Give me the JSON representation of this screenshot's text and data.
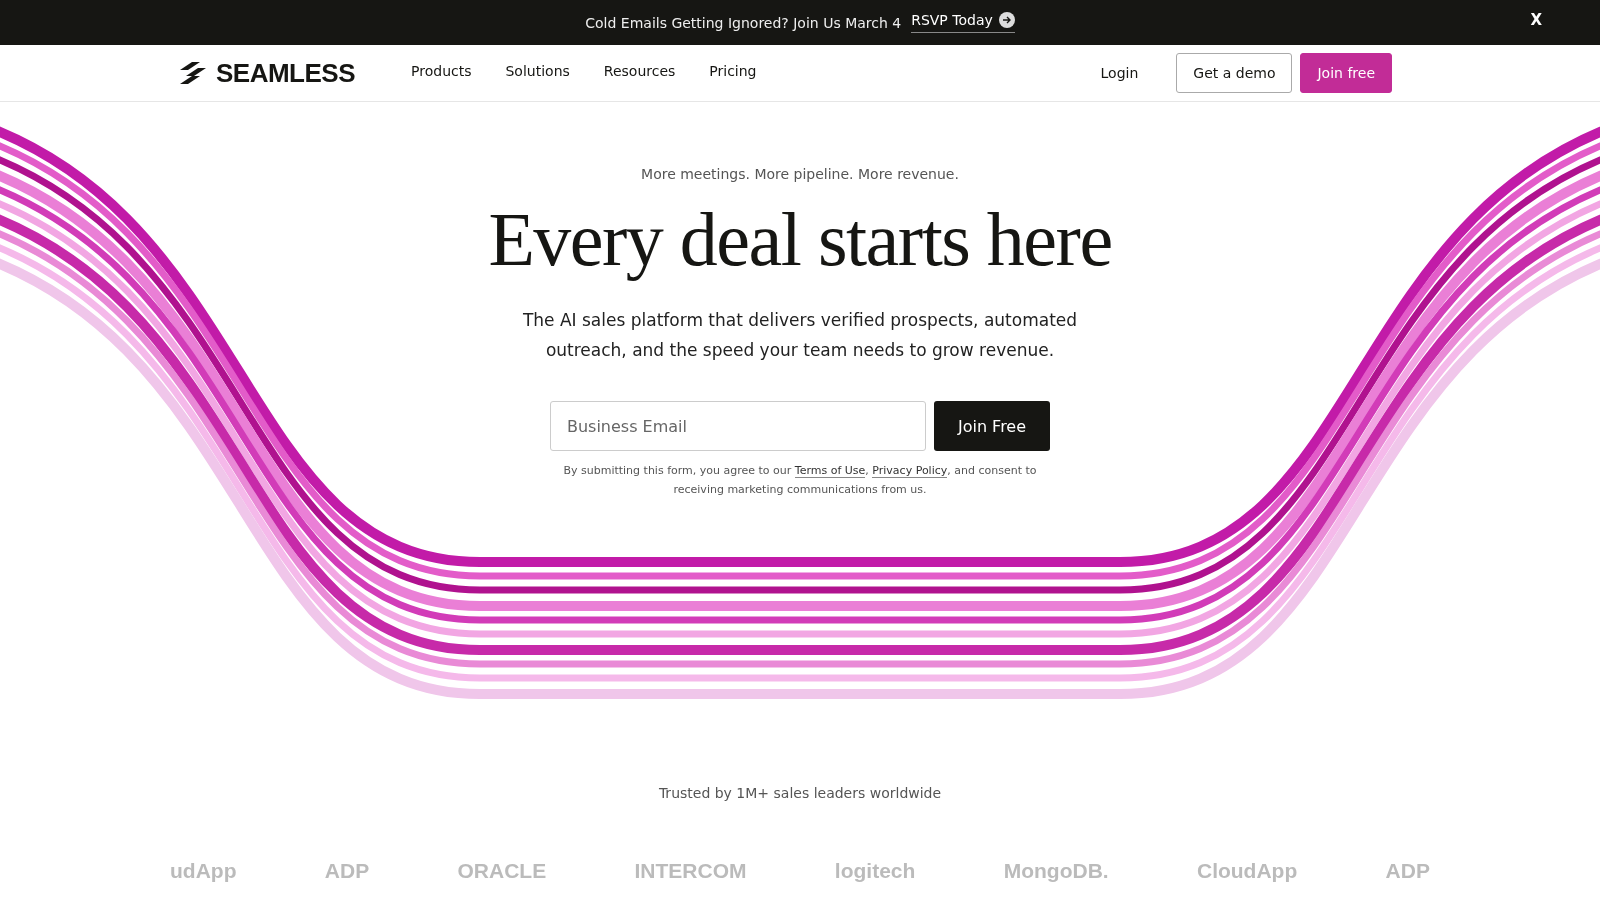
{
  "announcement": {
    "text": "Cold Emails Getting Ignored? Join Us March 4",
    "link": "RSVP Today",
    "close": "X"
  },
  "nav": {
    "logo": "SEAMLESS",
    "items": [
      "Products",
      "Solutions",
      "Resources",
      "Pricing"
    ],
    "login": "Login",
    "demo": "Get a demo",
    "join": "Join free"
  },
  "hero": {
    "eyebrow": "More meetings. More pipeline. More revenue.",
    "title": "Every deal starts here",
    "subtitle": "The AI sales platform that delivers verified prospects, automated outreach, and the speed your team needs to grow revenue.",
    "email_placeholder": "Business Email",
    "submit": "Join Free",
    "disclaimer": [
      {
        "kind": "text",
        "text": "By submitting this form, you agree to our "
      },
      {
        "kind": "link",
        "text": "Terms of Use"
      },
      {
        "kind": "text",
        "text": ", "
      },
      {
        "kind": "link",
        "text": "Privacy Policy"
      },
      {
        "kind": "text",
        "text": ", and consent to receiving marketing communications from us."
      }
    ]
  },
  "trusted": {
    "caption": "Trusted by 1M+ sales leaders worldwide",
    "logos": [
      "udApp",
      "ADP",
      "ORACLE",
      "INTERCOM",
      "logitech",
      "MongoDB.",
      "CloudApp",
      "ADP"
    ]
  }
}
